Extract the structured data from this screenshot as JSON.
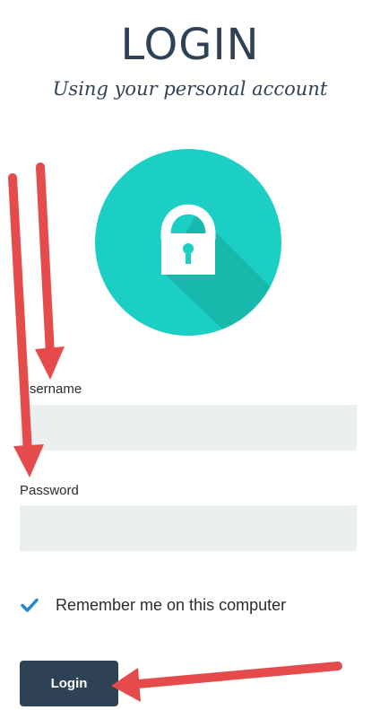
{
  "header": {
    "title": "LOGIN",
    "subtitle": "Using your personal account"
  },
  "form": {
    "username_label": "Username",
    "username_value": "",
    "password_label": "Password",
    "password_value": "",
    "remember_label": "Remember me on this computer",
    "remember_checked": true,
    "submit_label": "Login"
  },
  "icons": {
    "lock": "lock-icon",
    "checkbox": "check-icon"
  },
  "colors": {
    "navy": "#2f4154",
    "teal": "#1bcfc4",
    "teal_shadow": "#18b8ad",
    "field_bg": "#ebeff0",
    "check": "#1e88d0",
    "annotation_red": "#e64b4b"
  }
}
